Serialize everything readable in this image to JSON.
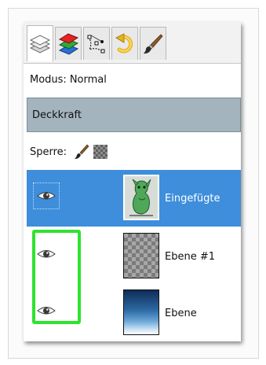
{
  "tabs": [
    {
      "name": "layers-tab-icon",
      "active": true
    },
    {
      "name": "channels-tab-icon",
      "active": false
    },
    {
      "name": "paths-tab-icon",
      "active": false
    },
    {
      "name": "undo-history-tab-icon",
      "active": false
    },
    {
      "name": "brushes-tab-icon",
      "active": false
    }
  ],
  "mode": {
    "label": "Modus:",
    "value": "Normal"
  },
  "opacity": {
    "label": "Deckkraft"
  },
  "lock": {
    "label": "Sperre:",
    "icons": [
      "lock-pixels-brush-icon",
      "lock-alpha-checker-icon"
    ]
  },
  "layers": [
    {
      "name": "Eingefügte",
      "visible": true,
      "selected": true,
      "thumbnail": "green-figure"
    },
    {
      "name": "Ebene #1",
      "visible": true,
      "selected": false,
      "thumbnail": "transparent"
    },
    {
      "name": "Ebene",
      "visible": true,
      "selected": false,
      "thumbnail": "blue-gradient"
    }
  ],
  "colors": {
    "selection": "#3e8edb",
    "opacity_bar": "#a4b4bf",
    "highlight": "#2ee32e"
  }
}
